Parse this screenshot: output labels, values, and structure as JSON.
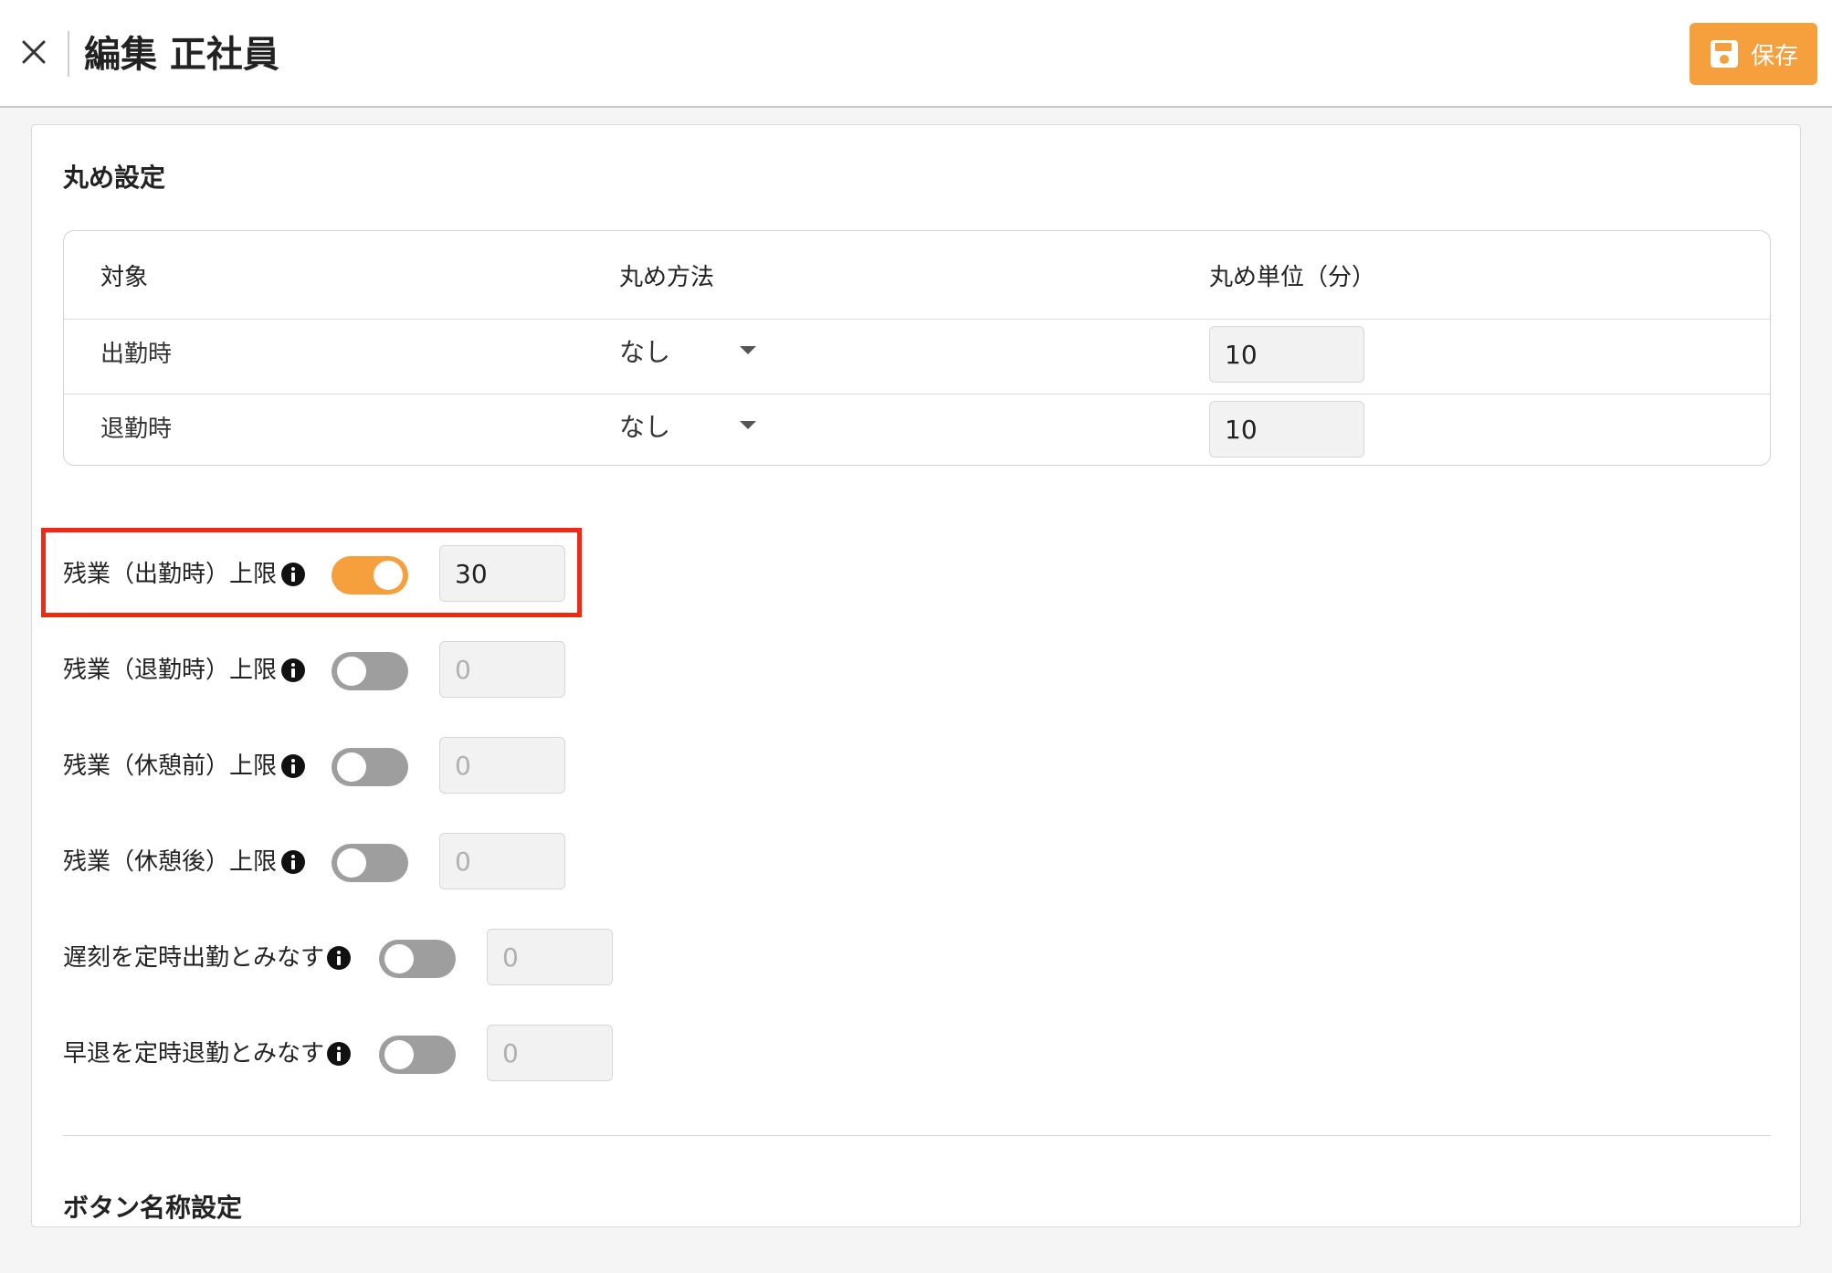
{
  "header": {
    "title": "編集 正社員",
    "save_label": "保存",
    "accent_color": "#f5a03c"
  },
  "rounding": {
    "section_title": "丸め設定",
    "columns": [
      "対象",
      "丸め方法",
      "丸め単位（分）"
    ],
    "rows": [
      {
        "target": "出勤時",
        "method": "なし",
        "unit": "10"
      },
      {
        "target": "退勤時",
        "method": "なし",
        "unit": "10"
      }
    ]
  },
  "settings": [
    {
      "label": "残業（出勤時）上限",
      "enabled": true,
      "value": "30"
    },
    {
      "label": "残業（退勤時）上限",
      "enabled": false,
      "value": "0"
    },
    {
      "label": "残業（休憩前）上限",
      "enabled": false,
      "value": "0"
    },
    {
      "label": "残業（休憩後）上限",
      "enabled": false,
      "value": "0"
    },
    {
      "label": "遅刻を定時出勤とみなす",
      "enabled": false,
      "value": "0"
    },
    {
      "label": "早退を定時退勤とみなす",
      "enabled": false,
      "value": "0"
    }
  ],
  "button_names": {
    "section_title": "ボタン名称設定"
  }
}
